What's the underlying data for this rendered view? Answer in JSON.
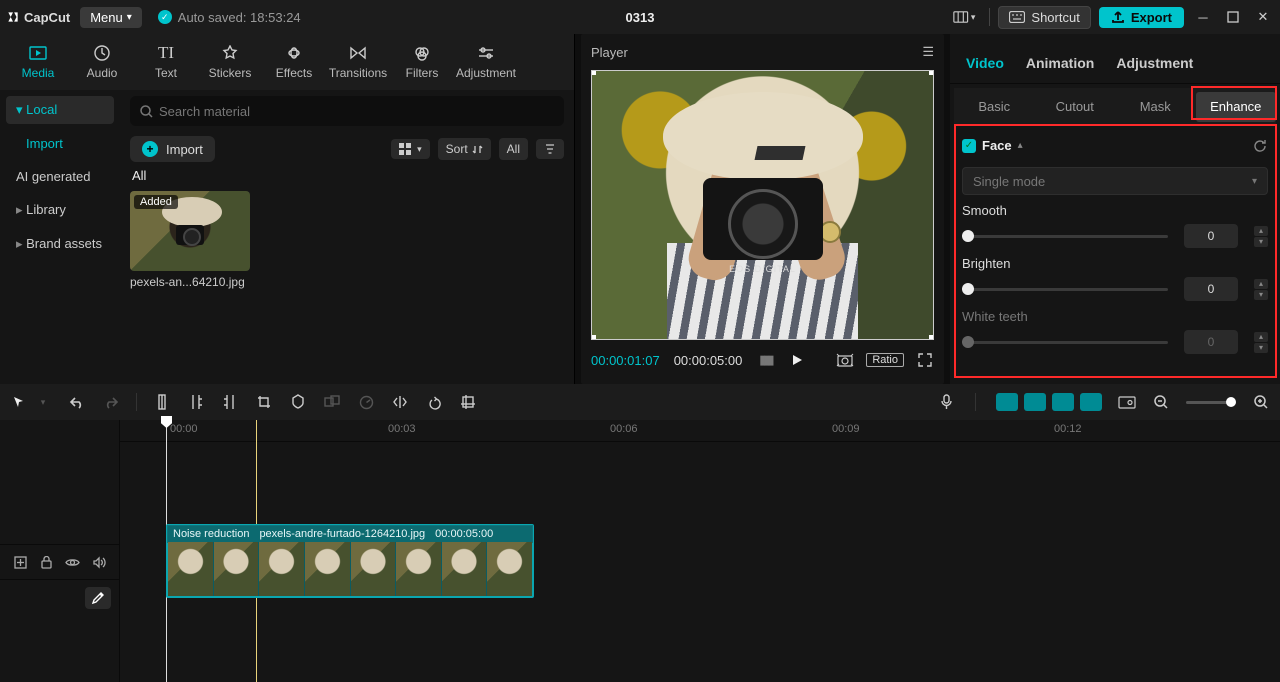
{
  "titlebar": {
    "brand": "CapCut",
    "menu": "Menu",
    "autosave": "Auto saved: 18:53:24",
    "project": "0313",
    "shortcut": "Shortcut",
    "export": "Export"
  },
  "mediaTabs": [
    "Media",
    "Audio",
    "Text",
    "Stickers",
    "Effects",
    "Transitions",
    "Filters",
    "Adjustment"
  ],
  "mediaTabActive": 0,
  "sideNav": {
    "local": "Local",
    "import": "Import",
    "ai": "AI generated",
    "library": "Library",
    "brand": "Brand assets"
  },
  "search": {
    "placeholder": "Search material"
  },
  "importBtn": "Import",
  "viewTools": {
    "sort": "Sort",
    "all": "All"
  },
  "allLabel": "All",
  "clipThumb": {
    "badge": "Added",
    "name": "pexels-an...64210.jpg"
  },
  "player": {
    "title": "Player",
    "current": "00:00:01:07",
    "duration": "00:00:05:00",
    "ratio": "Ratio",
    "cameraLabel": "EOS DIGITAL"
  },
  "rightTabs": [
    "Video",
    "Animation",
    "Adjustment"
  ],
  "rightTabActive": 0,
  "subTabs": [
    "Basic",
    "Cutout",
    "Mask",
    "Enhance"
  ],
  "subTabActive": 3,
  "enhance": {
    "face": "Face",
    "mode": "Single mode",
    "sliders": [
      {
        "label": "Smooth",
        "value": "0",
        "disabled": false
      },
      {
        "label": "Brighten",
        "value": "0",
        "disabled": false
      },
      {
        "label": "White teeth",
        "value": "0",
        "disabled": true
      }
    ]
  },
  "ruler": [
    "00:00",
    "00:03",
    "00:06",
    "00:09",
    "00:12"
  ],
  "timelineClip": {
    "effect": "Noise reduction",
    "file": "pexels-andre-furtado-1264210.jpg",
    "dur": "00:00:05:00"
  }
}
